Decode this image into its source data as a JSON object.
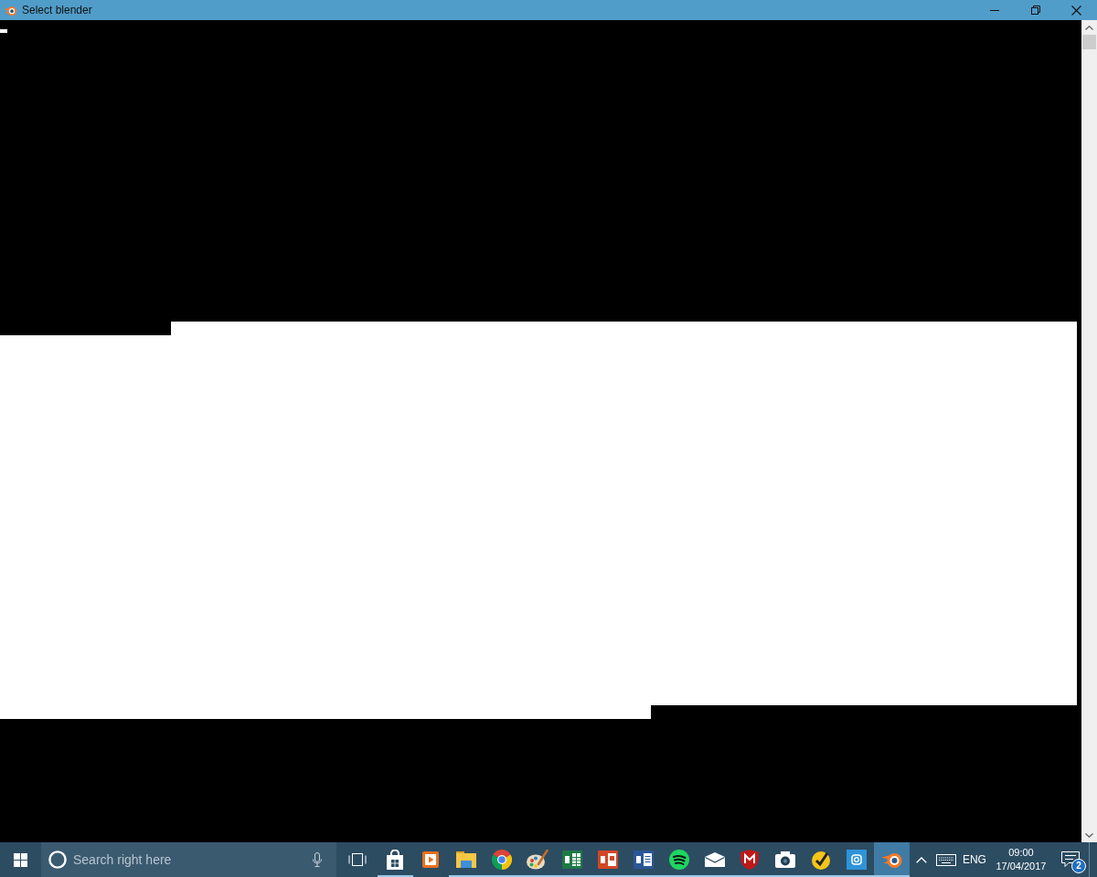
{
  "window": {
    "title": "Select blender"
  },
  "taskbar": {
    "search": {
      "placeholder": "Search right here"
    },
    "apps": [
      {
        "kind": "store",
        "running": true,
        "selected": false
      },
      {
        "kind": "player",
        "running": false,
        "selected": false
      },
      {
        "kind": "folder",
        "running": true,
        "selected": false
      },
      {
        "kind": "browser",
        "running": true,
        "selected": false
      },
      {
        "kind": "palette",
        "running": true,
        "selected": false
      },
      {
        "kind": "sheet",
        "running": true,
        "selected": false
      },
      {
        "kind": "slides",
        "running": true,
        "selected": false
      },
      {
        "kind": "doc",
        "running": true,
        "selected": false
      },
      {
        "kind": "music",
        "running": true,
        "selected": false
      },
      {
        "kind": "mail",
        "running": true,
        "selected": false
      },
      {
        "kind": "shield",
        "running": true,
        "selected": false
      },
      {
        "kind": "camera",
        "running": true,
        "selected": false
      },
      {
        "kind": "check",
        "running": true,
        "selected": false
      },
      {
        "kind": "square",
        "running": true,
        "selected": false
      },
      {
        "kind": "logo",
        "running": true,
        "selected": true
      }
    ],
    "tray": {
      "language": "ENG",
      "time": "09:00",
      "date": "17/04/2017",
      "notifications": "2"
    }
  }
}
